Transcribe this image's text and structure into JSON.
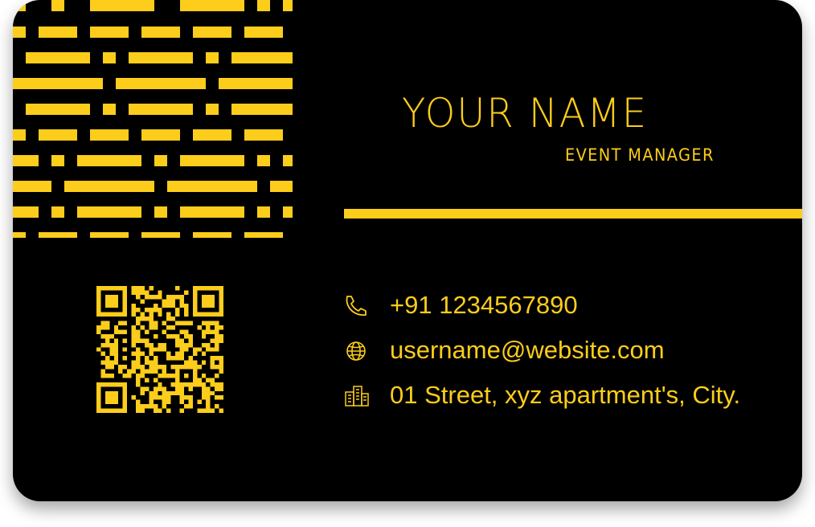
{
  "colors": {
    "accent": "#FCCD1B",
    "card_background": "#000000",
    "page_background": "#FFFFFF"
  },
  "card": {
    "name": "YOUR NAME",
    "job_title": "EVENT MANAGER"
  },
  "contacts": [
    {
      "icon": "phone-icon",
      "text": "+91 1234567890"
    },
    {
      "icon": "globe-icon",
      "text": "username@website.com"
    },
    {
      "icon": "building-icon",
      "text": "01 Street, xyz apartment's, City."
    }
  ],
  "qr_code": {
    "icon": "qr-code-icon"
  },
  "decoration": {
    "icon": "dash-pattern"
  }
}
